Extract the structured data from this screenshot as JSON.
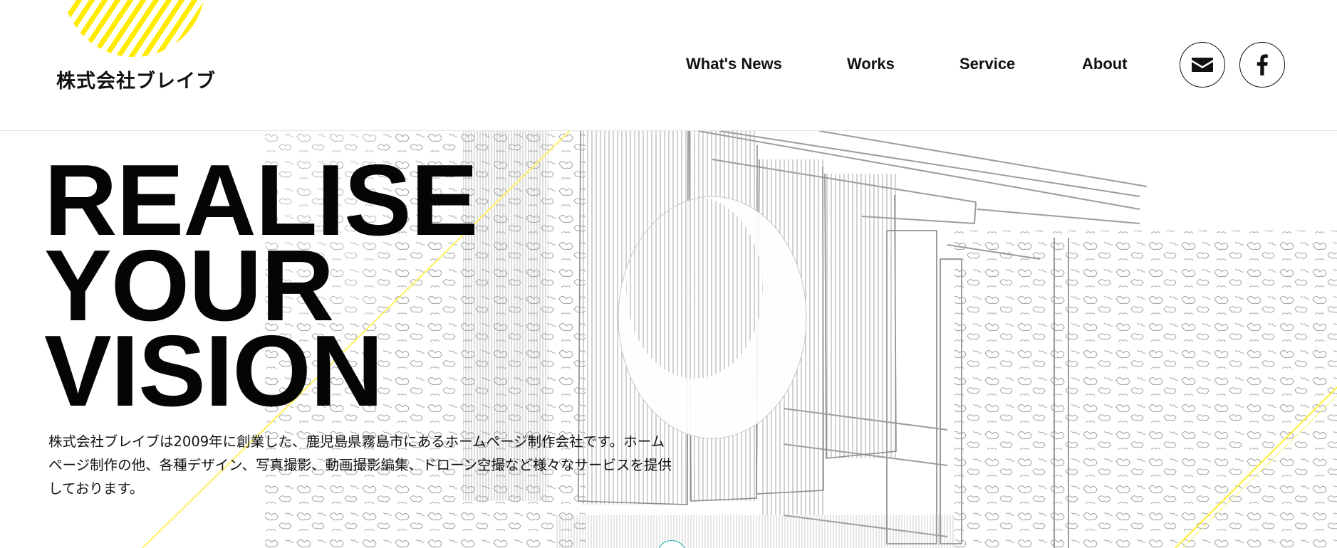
{
  "header": {
    "logo_text": "株式会社ブレイブ",
    "nav": [
      {
        "label": "What's News"
      },
      {
        "label": "Works"
      },
      {
        "label": "Service"
      },
      {
        "label": "About"
      }
    ],
    "icons": {
      "mail": "envelope-icon",
      "facebook": "facebook-icon"
    }
  },
  "hero": {
    "title_lines": [
      "REALISE",
      "YOUR",
      "VISION"
    ],
    "description": "株式会社ブレイブは2009年に創業した、鹿児島県霧島市にあるホームページ制作会社です。ホームページ制作の他、各種デザイン、写真撮影、動画撮影編集、ドローン空撮など様々なサービスを提供しております。"
  },
  "colors": {
    "accent": "#ffec00",
    "text": "#111111",
    "line_art": "#9a9a9a",
    "scroll_ring": "#2aa7b5"
  }
}
